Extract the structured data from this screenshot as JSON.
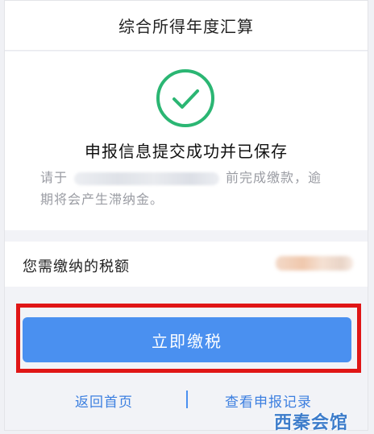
{
  "header": {
    "title": "综合所得年度汇算"
  },
  "result": {
    "icon": "check-circle-icon",
    "title": "申报信息提交成功并已保存",
    "notice_prefix": "请于",
    "notice_middle": "前完成缴款，逾",
    "notice_line2": "期将会产生滞纳金。"
  },
  "tax": {
    "label": "您需缴纳的税额"
  },
  "actions": {
    "pay_label": "立即缴税",
    "home_label": "返回首页",
    "records_label": "查看申报记录"
  },
  "watermark": {
    "text": "西秦会馆"
  },
  "colors": {
    "accent": "#4a90f0",
    "success": "#2bb673",
    "highlight": "#e01616",
    "link": "#3c7fe0"
  }
}
